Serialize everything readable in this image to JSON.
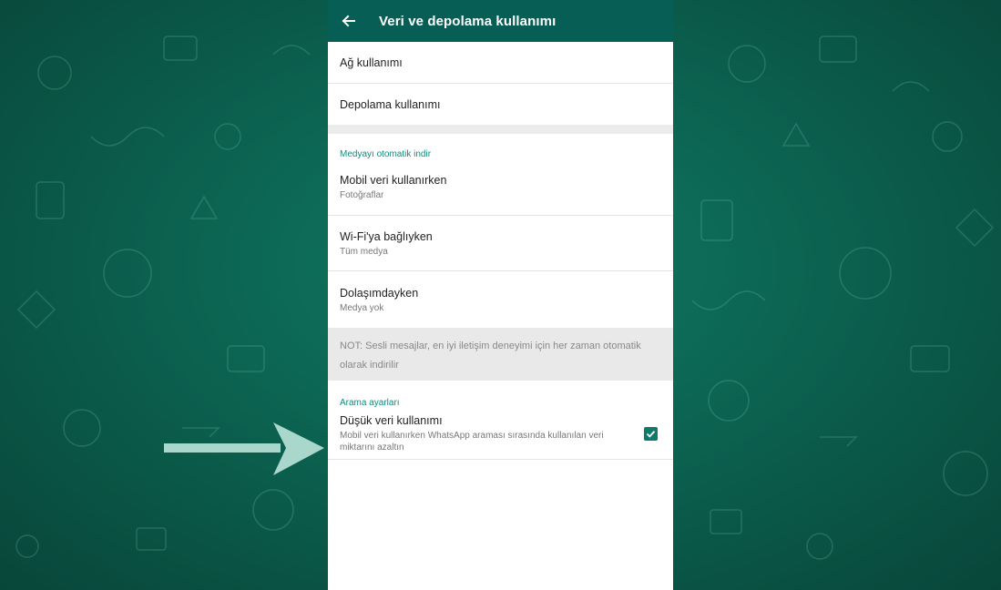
{
  "appbar": {
    "title": "Veri ve depolama kullanımı"
  },
  "rows_top": [
    {
      "label": "Ağ kullanımı"
    },
    {
      "label": "Depolama kullanımı"
    }
  ],
  "auto_download": {
    "header": "Medyayı otomatik indir",
    "items": [
      {
        "label": "Mobil veri kullanırken",
        "value": "Fotoğraflar"
      },
      {
        "label": "Wi-Fi'ya bağlıyken",
        "value": "Tüm medya"
      },
      {
        "label": "Dolaşımdayken",
        "value": "Medya yok"
      }
    ]
  },
  "note": {
    "text": "NOT: Sesli mesajlar, en iyi iletişim deneyimi için her zaman otomatik olarak indirilir"
  },
  "call_settings": {
    "header": "Arama ayarları",
    "low_data": {
      "label": "Düşük veri kullanımı",
      "description": "Mobil veri kullanırken WhatsApp araması sırasında kullanılan veri miktarını azaltın",
      "checked": true
    }
  },
  "colors": {
    "appbar": "#075e54",
    "accent": "#0e8c7c",
    "background": "#0b5d4c"
  },
  "icons": {
    "back": "arrow-left-icon",
    "check": "checkmark-icon",
    "pointer": "arrow-right-icon"
  }
}
